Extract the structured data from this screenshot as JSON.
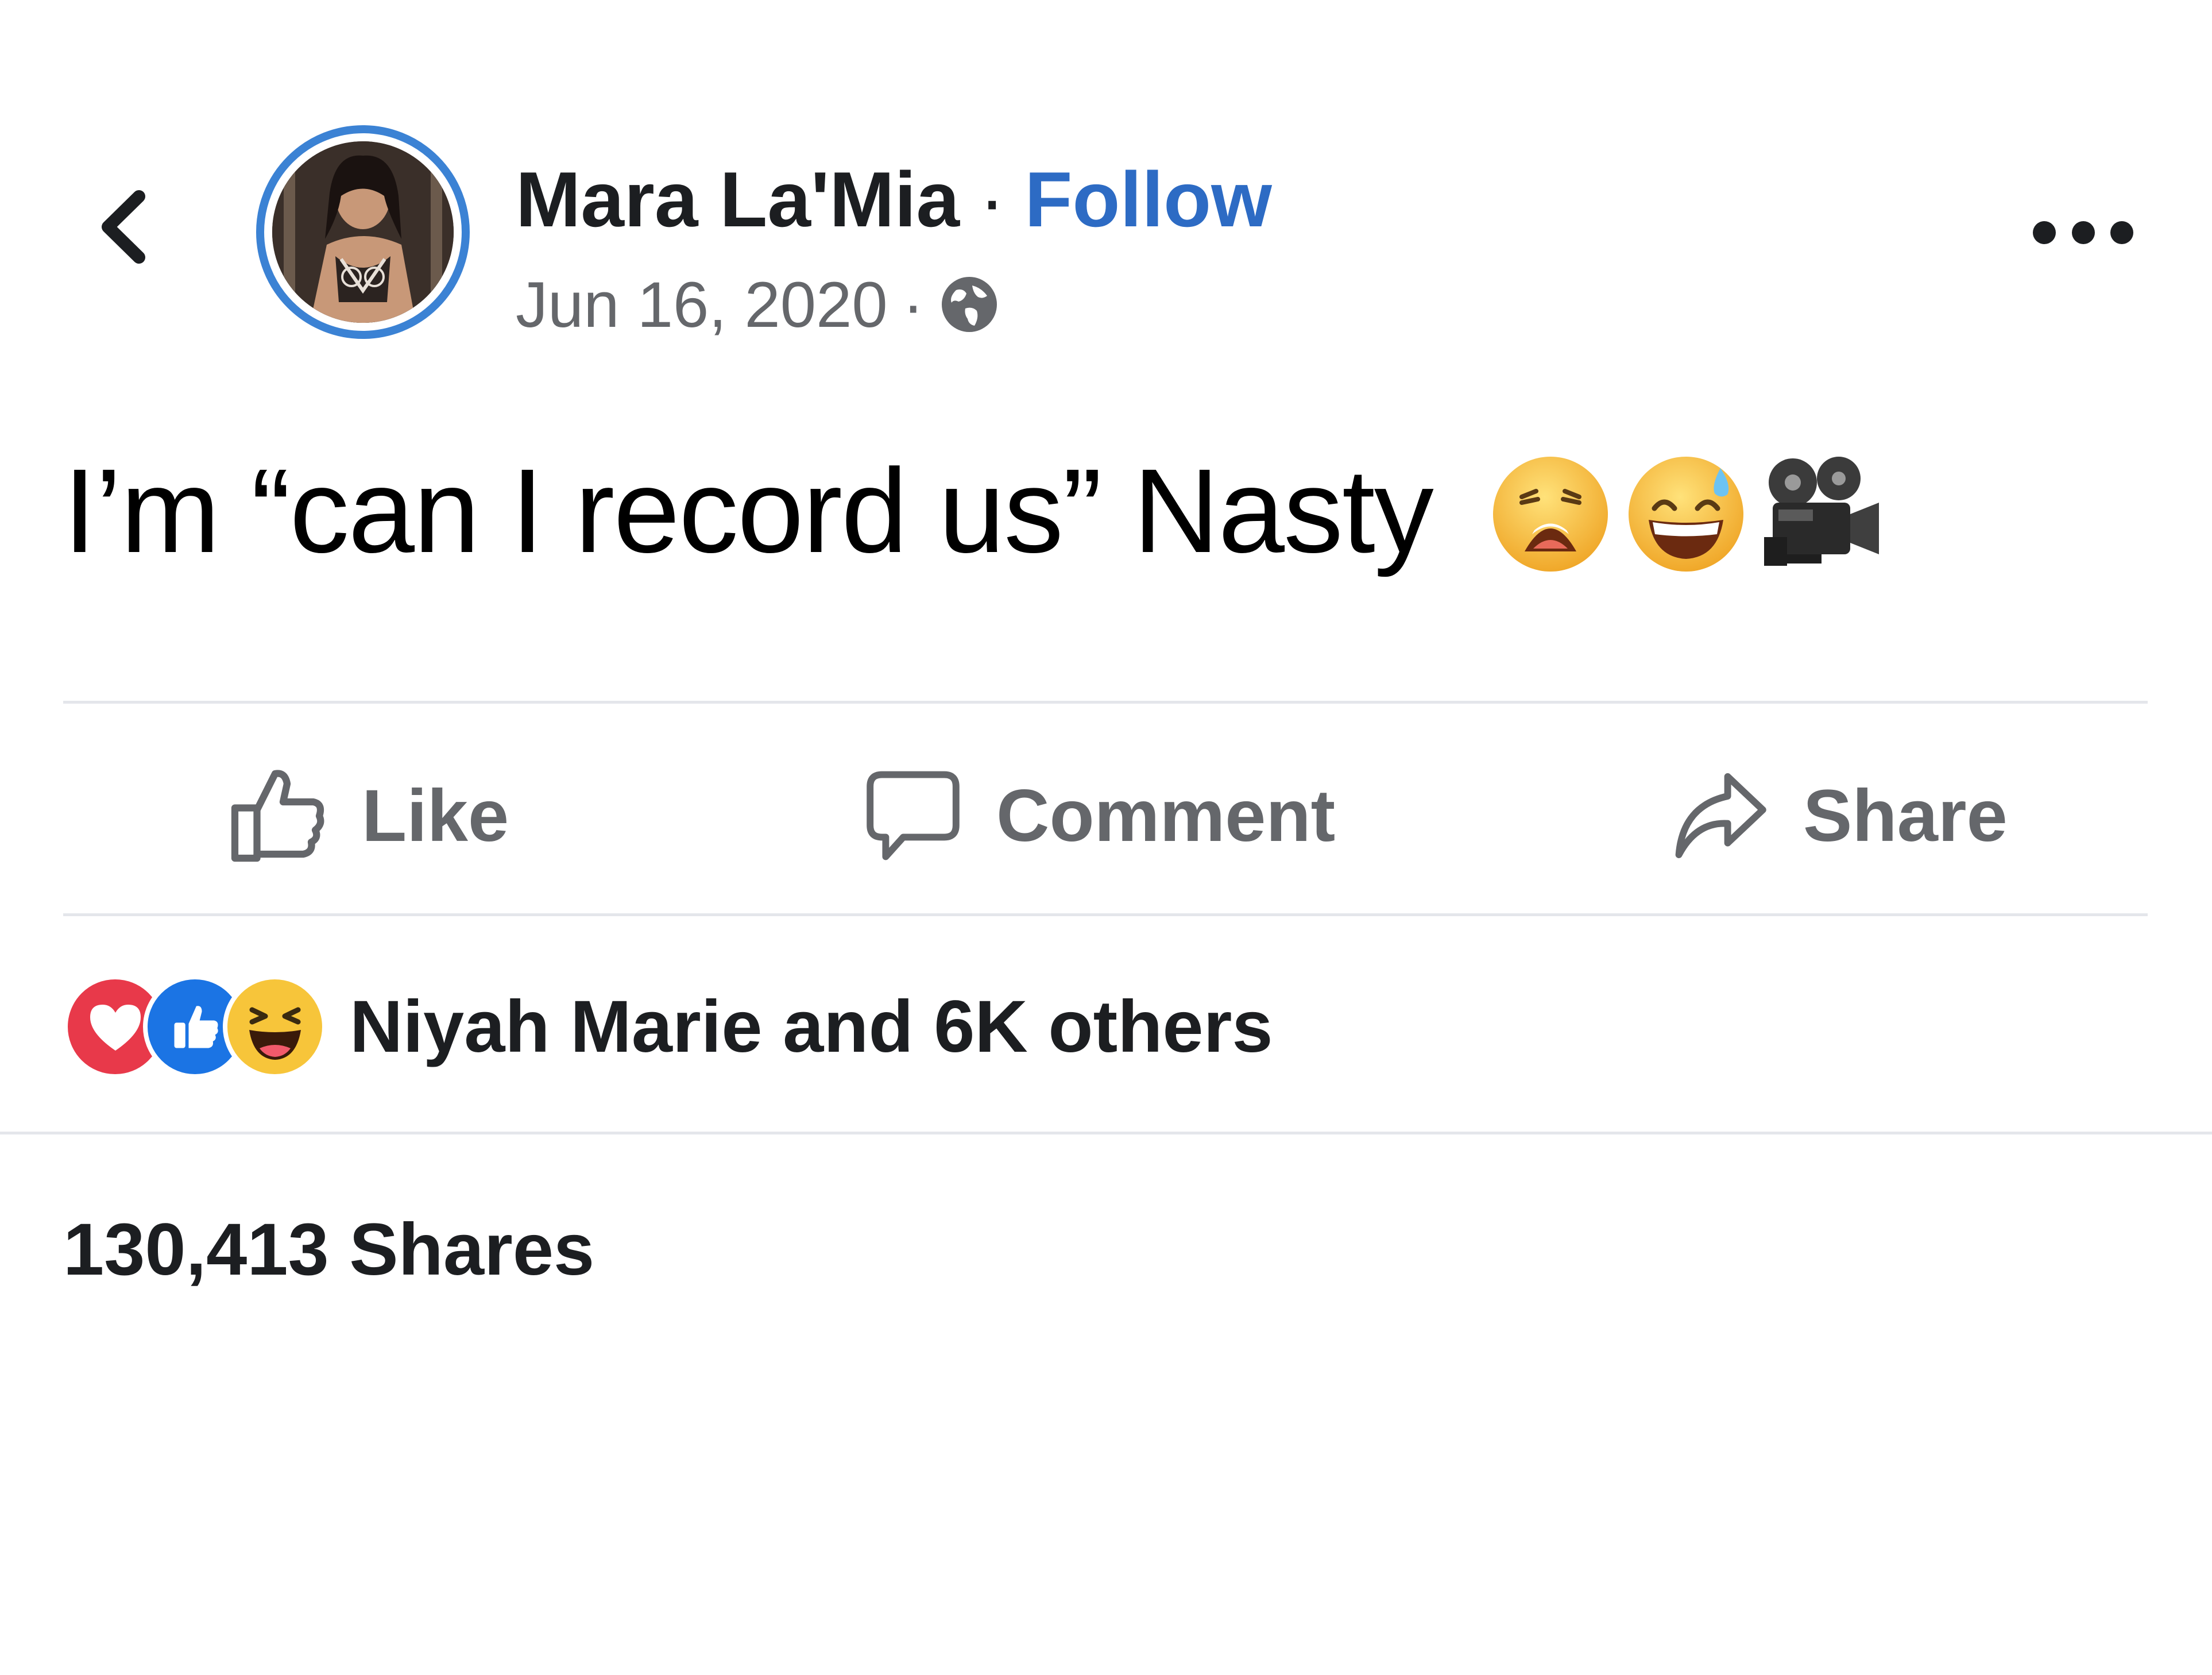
{
  "header": {
    "back_icon": "chevron-left-icon",
    "author_name": "Mara La'Mia",
    "separator": "·",
    "follow_label": "Follow",
    "date": "Jun 16, 2020",
    "meta_separator": "·",
    "privacy_icon": "globe-icon",
    "more_icon": "more-horizontal-icon"
  },
  "post": {
    "text": "I’m “can I record us” Nasty",
    "emojis": [
      "weary-face-emoji",
      "grinning-face-with-sweat-emoji",
      "movie-camera-emoji"
    ]
  },
  "actions": {
    "like_label": "Like",
    "comment_label": "Comment",
    "share_label": "Share"
  },
  "reactions": {
    "icons": [
      "love-reaction-icon",
      "like-reaction-icon",
      "haha-reaction-icon"
    ],
    "summary": "Niyah Marie and 6K others"
  },
  "stats": {
    "shares": "130,413 Shares"
  },
  "colors": {
    "accent": "#2d6bc4",
    "avatar_ring": "#3b82d4",
    "secondary_text": "#65676b",
    "divider": "#e4e6eb",
    "love": "#e8394a",
    "like": "#1b74e4",
    "emoji_yellow": "#f7c53a"
  }
}
